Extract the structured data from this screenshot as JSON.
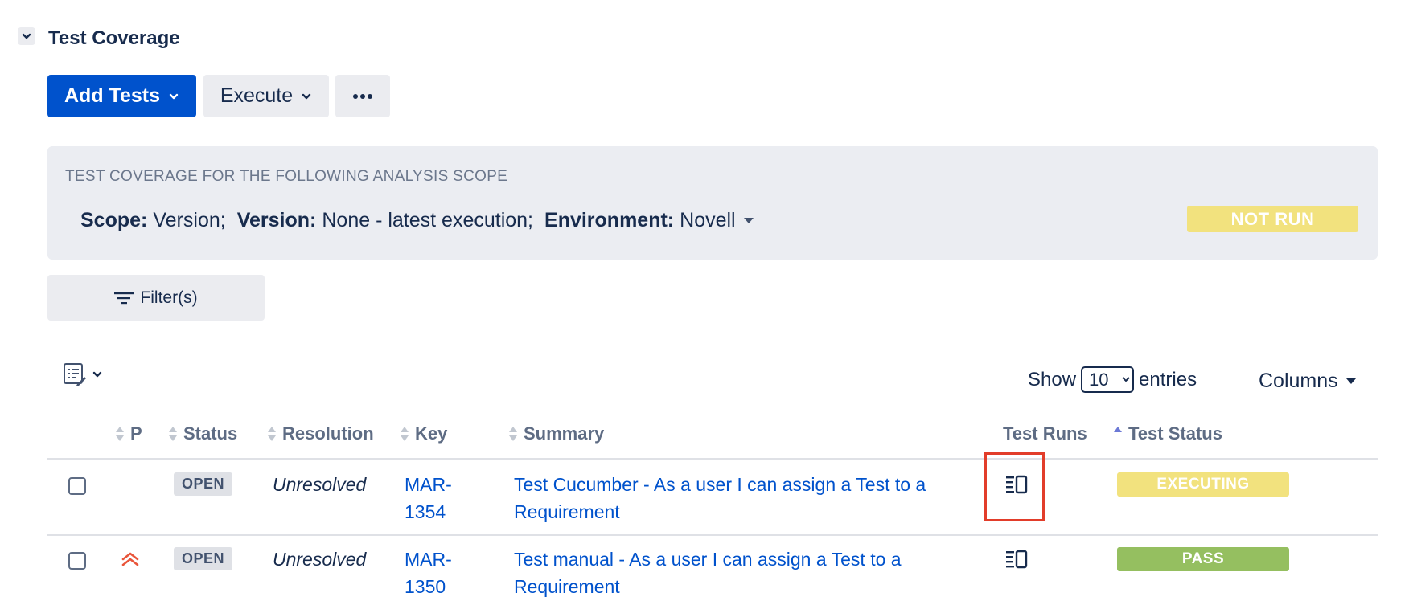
{
  "section": {
    "title": "Test Coverage"
  },
  "toolbar": {
    "add_tests_label": "Add Tests",
    "execute_label": "Execute",
    "more_label": "···"
  },
  "scope_panel": {
    "heading": "TEST COVERAGE FOR THE FOLLOWING ANALYSIS SCOPE",
    "scope_label": "Scope:",
    "scope_value": "Version;",
    "version_label": "Version:",
    "version_value": "None - latest execution;",
    "environment_label": "Environment:",
    "environment_value": "Novell",
    "overall_status": "NOT RUN",
    "overall_status_color": "#f2e27e"
  },
  "filters": {
    "label": "Filter(s)"
  },
  "table_controls": {
    "show_label": "Show",
    "page_size": "10",
    "entries_label": "entries",
    "columns_label": "Columns"
  },
  "table": {
    "headers": {
      "priority": "P",
      "status": "Status",
      "resolution": "Resolution",
      "key": "Key",
      "summary": "Summary",
      "test_runs": "Test Runs",
      "test_status": "Test Status"
    },
    "rows": [
      {
        "priority_icon": "",
        "status": "OPEN",
        "resolution": "Unresolved",
        "key_line1": "MAR-",
        "key_line2": "1354",
        "summary_line1": "Test Cucumber - As a user I can assign a Test to a",
        "summary_line2": "Requirement",
        "test_status": "EXECUTING",
        "test_status_color": "#f2e27e"
      },
      {
        "priority_icon": "highest-priority-icon",
        "status": "OPEN",
        "resolution": "Unresolved",
        "key_line1": "MAR-",
        "key_line2": "1350",
        "summary_line1": "Test manual - As a user I can assign a Test to a",
        "summary_line2": "Requirement",
        "test_status": "PASS",
        "test_status_color": "#95bf60"
      }
    ]
  },
  "colors": {
    "primary": "#0052cc",
    "highlight": "#e23d2a",
    "priority_highest": "#e9553a"
  }
}
